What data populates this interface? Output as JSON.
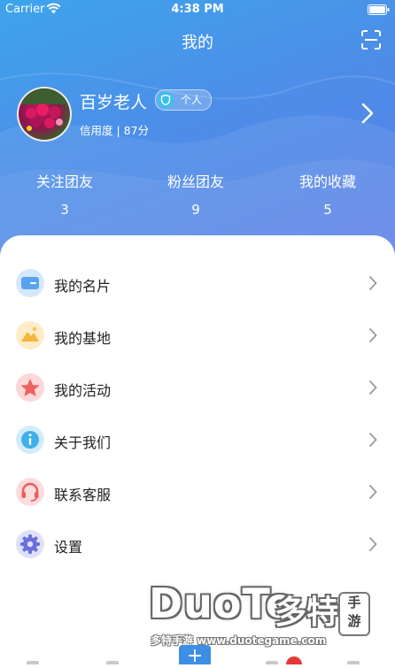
{
  "status_bar": {
    "carrier": "Carrier",
    "time": "4:38 PM"
  },
  "nav": {
    "title": "我的"
  },
  "profile": {
    "name": "百岁老人",
    "badge": "个人",
    "credit": "信用度 | 87分"
  },
  "stats": [
    {
      "label": "关注团友",
      "value": "3"
    },
    {
      "label": "粉丝团友",
      "value": "9"
    },
    {
      "label": "我的收藏",
      "value": "5"
    }
  ],
  "menu": [
    {
      "label": "我的名片",
      "icon": "card-icon",
      "color": "#5aa2f0"
    },
    {
      "label": "我的基地",
      "icon": "mountain-icon",
      "color": "#f5b43a"
    },
    {
      "label": "我的活动",
      "icon": "star-icon",
      "color": "#f0625e"
    },
    {
      "label": "关于我们",
      "icon": "info-icon",
      "color": "#3fb0ec"
    },
    {
      "label": "联系客服",
      "icon": "headset-icon",
      "color": "#ef5b5b"
    },
    {
      "label": "设置",
      "icon": "gear-icon",
      "color": "#6a6fdc"
    }
  ],
  "watermark": {
    "logo": "DuoTe",
    "cn": "多特",
    "box_top": "手",
    "box_bottom": "游",
    "url": "多特手游 www.duotegame.com"
  },
  "tabbar": {
    "add_label": "+"
  },
  "colors": {
    "header_start": "#3ea4ec",
    "header_end": "#5b7ee6",
    "accent": "#3d8fe6"
  }
}
